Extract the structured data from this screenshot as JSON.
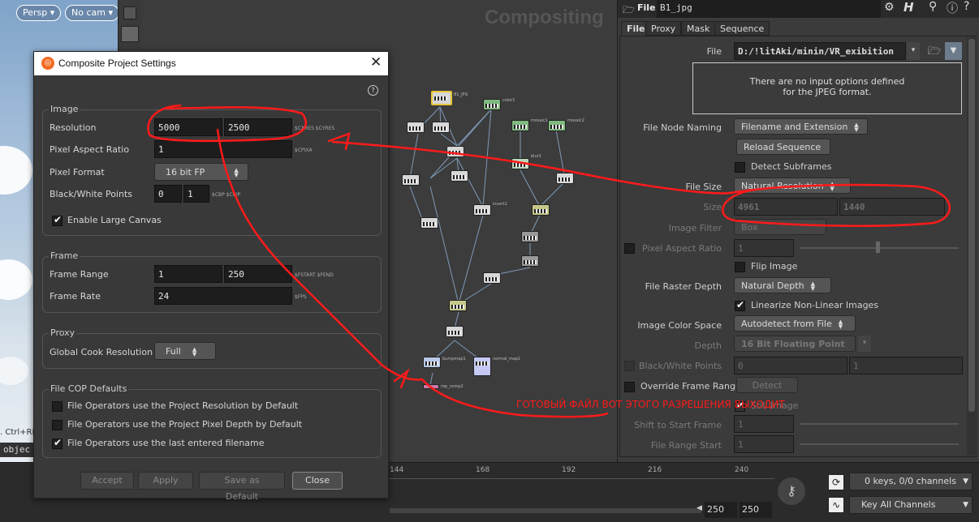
{
  "viewport": {
    "persp_label": "Persp",
    "cam_label": "No cam",
    "hint_text": ". Ctrl+Ri",
    "object_text": "objec"
  },
  "network": {
    "title": "Compositing",
    "nodes": [
      "B1_JPG",
      "color1",
      "composite1",
      "composite2",
      "mosaic1",
      "mosaic2",
      "blur1",
      "invert1",
      "median1",
      "vopcop2filter1",
      "over1",
      "switch1",
      "switch2",
      "composite3",
      "composite4",
      "normal_map1",
      "rop_comp2",
      "bumpmap1"
    ]
  },
  "params": {
    "node_type": "File",
    "node_name": "B1_jpg",
    "tabs": [
      "File",
      "Proxy",
      "Mask",
      "Sequence"
    ],
    "file_label": "File",
    "file_value": "D:/!litAki/minin/VR_exibition",
    "info_line1": "There are no input options defined",
    "info_line2": "for the JPEG format.",
    "naming_label": "File Node Naming",
    "naming_value": "Filename and Extension",
    "reload_label": "Reload Sequence",
    "detect_subframes_label": "Detect Subframes",
    "file_size_label": "File Size",
    "file_size_value": "Natural Resolution",
    "size_label": "Size",
    "size_w": "4961",
    "size_h": "1440",
    "image_filter_label": "Image Filter",
    "image_filter_value": "Box",
    "par_label": "Pixel Aspect Ratio",
    "par_value": "1",
    "flip_label": "Flip Image",
    "raster_depth_label": "File Raster Depth",
    "raster_depth_value": "Natural Depth",
    "linearize_label": "Linearize Non-Linear Images",
    "color_space_label": "Image Color Space",
    "color_space_value": "Autodetect from File",
    "depth_label": "Depth",
    "depth_value": "16 Bit Floating Point",
    "bw_label": "Black/White Points",
    "bw_black": "0",
    "bw_white": "1",
    "override_label": "Override Frame Range",
    "detect_label": "Detect",
    "still_label": "Still Image",
    "shift_label": "Shift to Start Frame",
    "shift_value": "1",
    "range_start_label": "File Range Start",
    "range_start_value": "1"
  },
  "annotation": {
    "text": "ГОТОВЫЙ ФАЙЛ ВОТ ЭТОГО РАЗРЕШЕНИЯ ВЫХОДИТ",
    "color": "#ff1a1a"
  },
  "timeline": {
    "ticks": [
      "144",
      "168",
      "192",
      "216",
      "240"
    ],
    "frame_a": "250",
    "frame_b": "250",
    "keys_label": "0 keys, 0/0 channels",
    "key_all_label": "Key All Channels"
  },
  "dialog": {
    "title": "Composite Project Settings",
    "help": "?",
    "image_group": "Image",
    "resolution_label": "Resolution",
    "res_x": "5000",
    "res_y": "2500",
    "res_vars": "$CXRES $CYRES",
    "par_label": "Pixel Aspect Ratio",
    "par_value": "1",
    "par_var": "$CPIXA",
    "pixel_format_label": "Pixel Format",
    "pixel_format_value": "16 bit FP",
    "bw_label": "Black/White Points",
    "bw_black": "0",
    "bw_white": "1",
    "bw_vars": "$CBP $CWP",
    "large_canvas_label": "Enable Large Canvas",
    "frame_group": "Frame",
    "frame_range_label": "Frame Range",
    "frame_start": "1",
    "frame_end": "250",
    "frame_vars": "$FSTART $FEND",
    "frame_rate_label": "Frame Rate",
    "frame_rate_value": "24",
    "frame_rate_var": "$FPS",
    "proxy_group": "Proxy",
    "cook_res_label": "Global Cook Resolution",
    "cook_res_value": "Full",
    "cop_group": "File COP Defaults",
    "cop_opt1": "File Operators use the Project Resolution by Default",
    "cop_opt2": "File Operators use the Project Pixel Depth by Default",
    "cop_opt3": "File Operators use the last entered filename",
    "accept": "Accept",
    "apply": "Apply",
    "save_default": "Save as Default",
    "close": "Close"
  }
}
